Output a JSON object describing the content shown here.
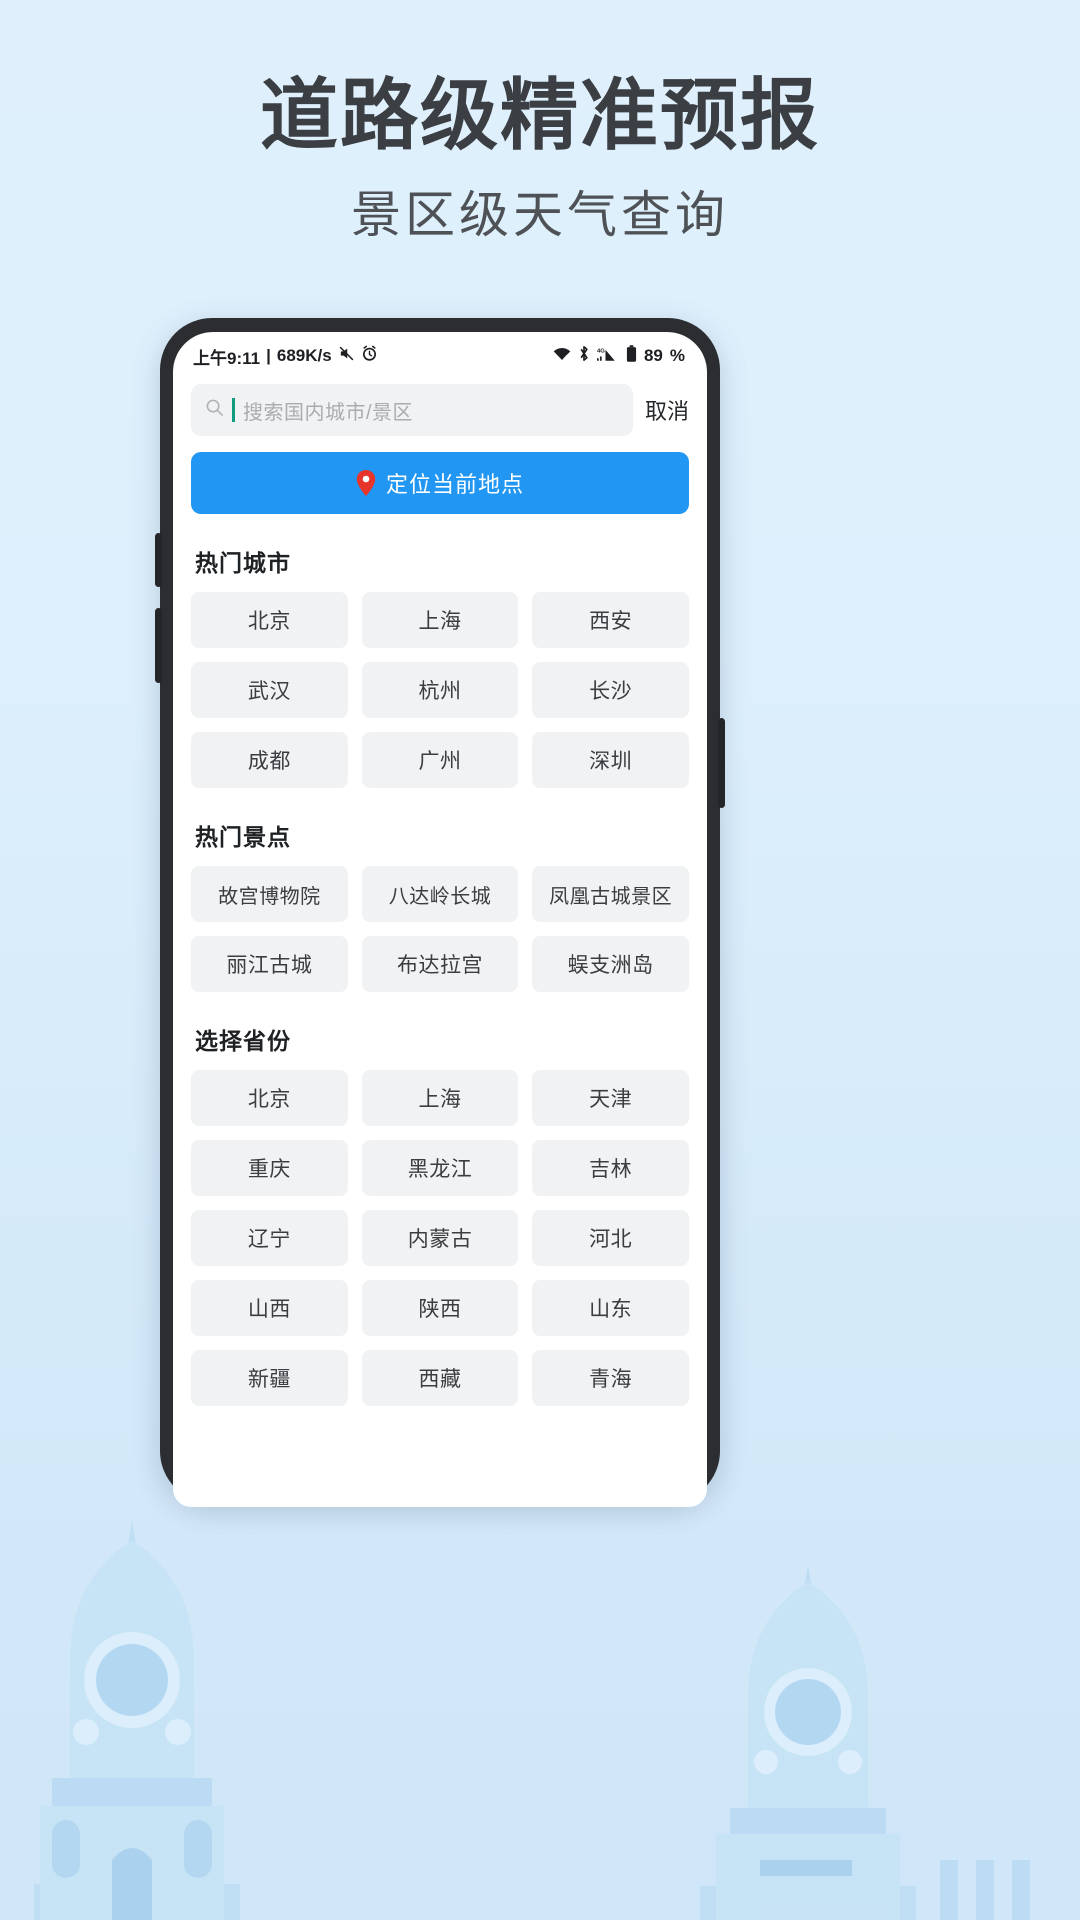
{
  "promo": {
    "headline": "道路级精准预报",
    "subhead": "景区级天气查询"
  },
  "colors": {
    "background_top": "#dff0fc",
    "background_bottom": "#cfe6f8",
    "accent_blue": "#2196f3",
    "pin_red": "#e8352b",
    "chip_bg": "#f1f2f3",
    "caret_teal": "#0f9b7e",
    "headline_gray": "#3b3f43"
  },
  "statusbar": {
    "time": "上午9:11",
    "separator": "|",
    "network_speed": "689K/s",
    "left_icons": [
      "mute-icon",
      "alarm-icon"
    ],
    "right_icons": [
      "wifi-icon",
      "bluetooth-icon",
      "signal-4g-icon",
      "battery-icon"
    ],
    "battery_percent": "89",
    "battery_unit": "%"
  },
  "search": {
    "icon": "search-icon",
    "placeholder": "搜索国内城市/景区",
    "value": "",
    "cancel_label": "取消"
  },
  "locate_button": {
    "icon": "map-pin-icon",
    "label": "定位当前地点"
  },
  "sections": [
    {
      "id": "hot-cities",
      "title": "热门城市",
      "items": [
        "北京",
        "上海",
        "西安",
        "武汉",
        "杭州",
        "长沙",
        "成都",
        "广州",
        "深圳"
      ]
    },
    {
      "id": "hot-attractions",
      "title": "热门景点",
      "items": [
        "故宫博物院",
        "八达岭长城",
        "凤凰古城景区",
        "丽江古城",
        "布达拉宫",
        "蜈支洲岛"
      ]
    },
    {
      "id": "provinces",
      "title": "选择省份",
      "items": [
        "北京",
        "上海",
        "天津",
        "重庆",
        "黑龙江",
        "吉林",
        "辽宁",
        "内蒙古",
        "河北",
        "山西",
        "陕西",
        "山东",
        "新疆",
        "西藏",
        "青海"
      ]
    }
  ]
}
